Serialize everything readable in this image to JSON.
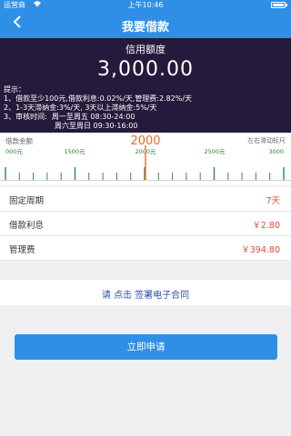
{
  "status_bar": {
    "carrier": "运营商",
    "wifi_icon": "wifi-icon",
    "time": "上午10:46"
  },
  "nav": {
    "back_icon": "chevron-left-icon",
    "title": "我要借款"
  },
  "credit": {
    "label": "信用额度",
    "amount": "3,000.00",
    "tips": "提示：\n1、借款至少100元,借款利息:0.02%/天,管理费:2.82%/天\n2、1-3天滞纳金:3%/天, 3天以上滞纳金:5%/天\n3、审核时间:  周一至周五 08:30-24:00\n                      周六至周日 09:30-16:00"
  },
  "ruler": {
    "label": "借款金额",
    "hint": "左右滑动标尺",
    "value": "2000",
    "ticks": [
      "000元",
      "1500元",
      "2000元",
      "2500元",
      "3000"
    ]
  },
  "details": [
    {
      "key": "固定周期",
      "value": "7天"
    },
    {
      "key": "借款利息",
      "value": "￥2.80"
    },
    {
      "key": "管理费",
      "value": "￥394.80"
    }
  ],
  "contract": {
    "text": "请 点击 签署电子合同"
  },
  "apply_button": {
    "label": "立即申请"
  },
  "colors": {
    "primary": "#2f8fe6",
    "header_dark": "#241a3b",
    "accent": "#e56a2c",
    "value_red": "#e34a3a",
    "link_blue": "#2b4fa8",
    "tick_green": "#2e8b3e"
  }
}
